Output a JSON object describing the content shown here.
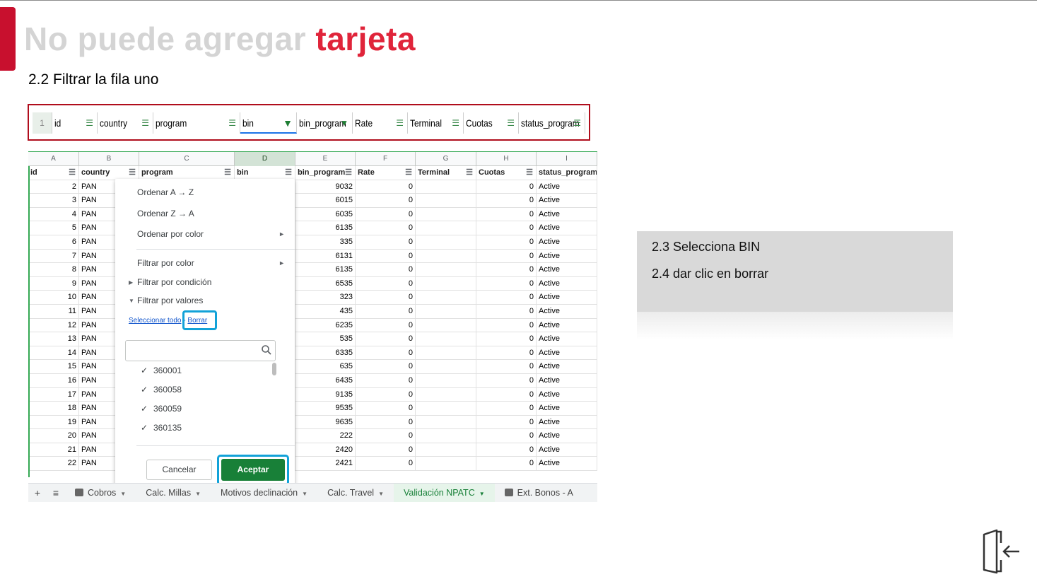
{
  "slide": {
    "title_part1": "No puede agregar",
    "title_part2": "tarjeta",
    "step": "2.2 Filtrar la fila uno",
    "accent_color": "#e0243a"
  },
  "zoom_header": {
    "row_number": "1",
    "columns": [
      {
        "label": "id",
        "filter": "filter-icon",
        "active": false
      },
      {
        "label": "country",
        "filter": "filter-icon",
        "active": false
      },
      {
        "label": "program",
        "filter": "filter-icon",
        "active": false
      },
      {
        "label": "bin",
        "filter": "filter-active-icon",
        "active": true
      },
      {
        "label": "bin_program",
        "filter": "filter-active-icon",
        "active": false
      },
      {
        "label": "Rate",
        "filter": "filter-icon",
        "active": false
      },
      {
        "label": "Terminal",
        "filter": "filter-icon",
        "active": false
      },
      {
        "label": "Cuotas",
        "filter": "filter-icon",
        "active": false
      },
      {
        "label": "status_program",
        "filter": "filter-icon",
        "active": false
      }
    ]
  },
  "sheet": {
    "column_letters": [
      "A",
      "B",
      "C",
      "D",
      "E",
      "F",
      "G",
      "H",
      "I"
    ],
    "header": [
      "id",
      "country",
      "program",
      "bin",
      "bin_program",
      "Rate",
      "Terminal",
      "Cuotas",
      "status_program"
    ],
    "rows": [
      [
        "2",
        "PAN",
        "9032",
        "0",
        "0",
        "Active"
      ],
      [
        "3",
        "PAN",
        "6015",
        "0",
        "0",
        "Active"
      ],
      [
        "4",
        "PAN",
        "6035",
        "0",
        "0",
        "Active"
      ],
      [
        "5",
        "PAN",
        "6135",
        "0",
        "0",
        "Active"
      ],
      [
        "6",
        "PAN",
        "335",
        "0",
        "0",
        "Active"
      ],
      [
        "7",
        "PAN",
        "6131",
        "0",
        "0",
        "Active"
      ],
      [
        "8",
        "PAN",
        "6135",
        "0",
        "0",
        "Active"
      ],
      [
        "9",
        "PAN",
        "6535",
        "0",
        "0",
        "Active"
      ],
      [
        "10",
        "PAN",
        "323",
        "0",
        "0",
        "Active"
      ],
      [
        "11",
        "PAN",
        "435",
        "0",
        "0",
        "Active"
      ],
      [
        "12",
        "PAN",
        "6235",
        "0",
        "0",
        "Active"
      ],
      [
        "13",
        "PAN",
        "535",
        "0",
        "0",
        "Active"
      ],
      [
        "14",
        "PAN",
        "6335",
        "0",
        "0",
        "Active"
      ],
      [
        "15",
        "PAN",
        "635",
        "0",
        "0",
        "Active"
      ],
      [
        "16",
        "PAN",
        "6435",
        "0",
        "0",
        "Active"
      ],
      [
        "17",
        "PAN",
        "9135",
        "0",
        "0",
        "Active"
      ],
      [
        "18",
        "PAN",
        "9535",
        "0",
        "0",
        "Active"
      ],
      [
        "19",
        "PAN",
        "9635",
        "0",
        "0",
        "Active"
      ],
      [
        "20",
        "PAN",
        "222",
        "0",
        "0",
        "Active"
      ],
      [
        "21",
        "PAN",
        "2420",
        "0",
        "0",
        "Active"
      ],
      [
        "22",
        "PAN",
        "2421",
        "0",
        "0",
        "Active"
      ]
    ]
  },
  "filter_menu": {
    "sort_az": "Ordenar A → Z",
    "sort_za": "Ordenar Z → A",
    "sort_color": "Ordenar por color",
    "filter_color": "Filtrar por color",
    "filter_condition": "Filtrar por condición",
    "filter_values": "Filtrar por valores",
    "select_all": "Seleccionar todo",
    "separator": "-",
    "clear": "Borrar",
    "search_value": "",
    "values": [
      "360001",
      "360058",
      "360059",
      "360135"
    ],
    "cancel": "Cancelar",
    "accept": "Aceptar"
  },
  "tabs": {
    "items": [
      {
        "label": "Cobros",
        "icon": "sheet-icon",
        "active": false
      },
      {
        "label": "Calc. Millas",
        "active": false
      },
      {
        "label": "Motivos declinación",
        "active": false
      },
      {
        "label": "Calc. Travel",
        "active": false
      },
      {
        "label": "Validación NPATC",
        "active": true
      },
      {
        "label": "Ext. Bonos - A",
        "icon": "lock-icon",
        "active": false
      }
    ]
  },
  "note": {
    "line1": "2.3 Selecciona BIN",
    "line2": "2.4 dar clic en borrar"
  }
}
